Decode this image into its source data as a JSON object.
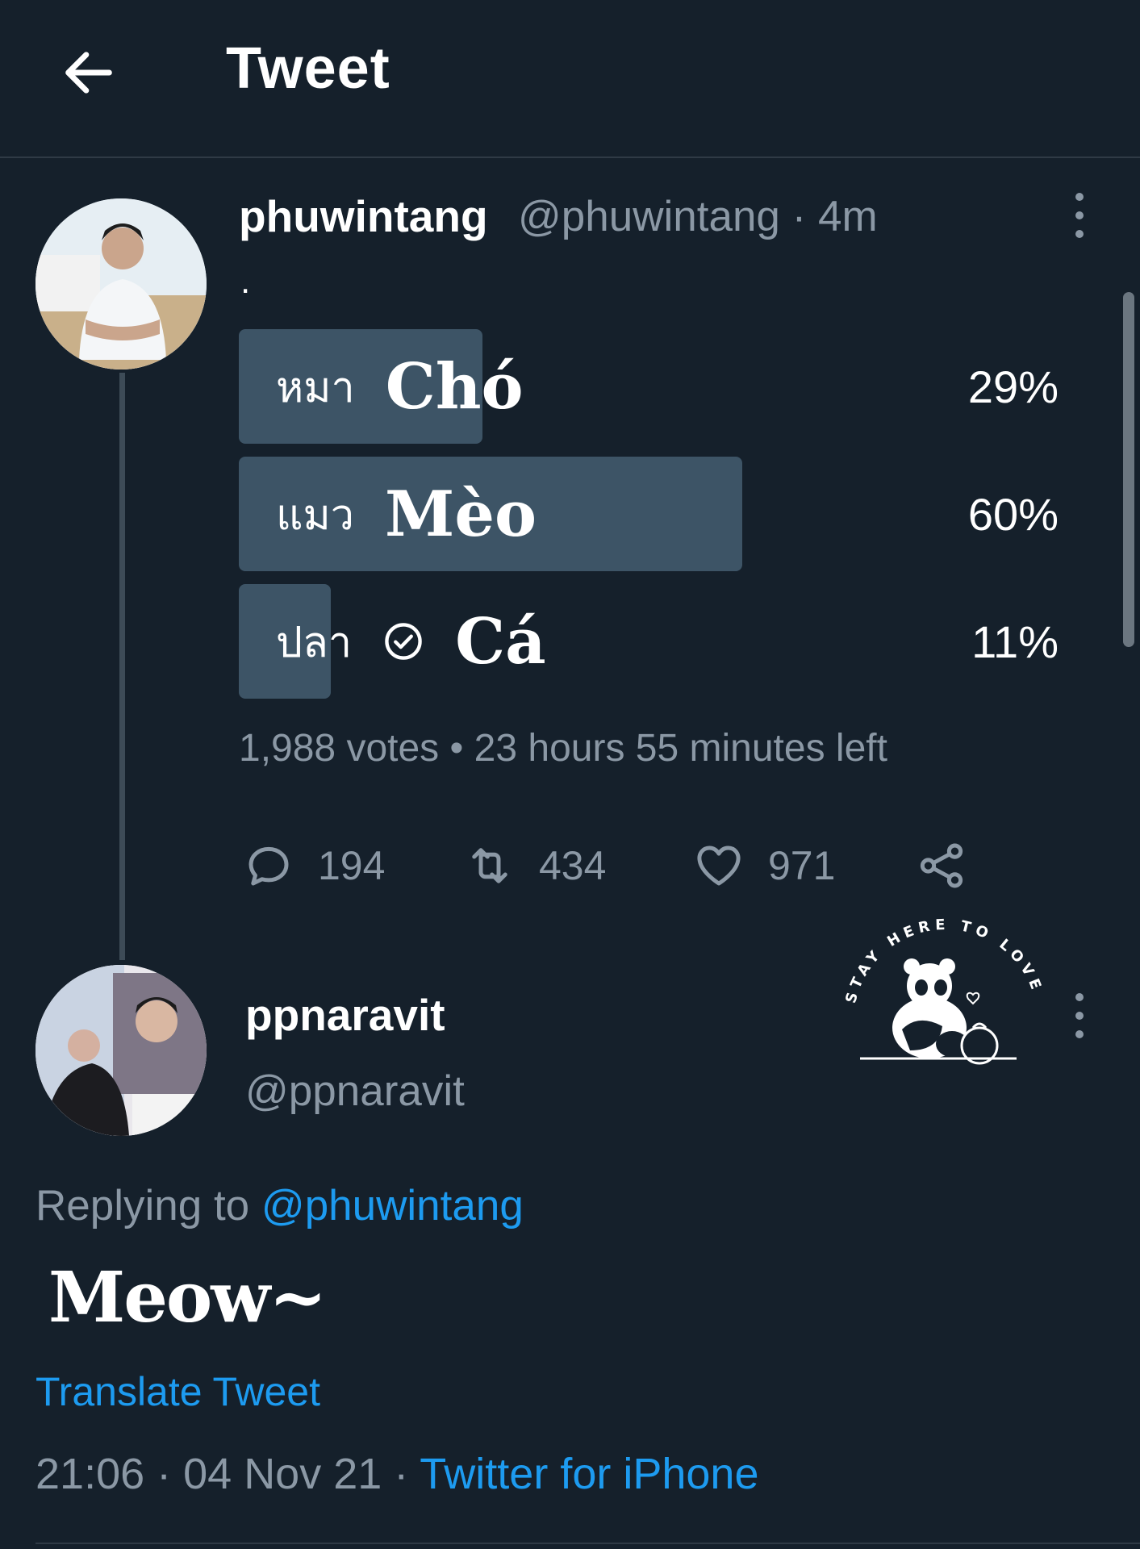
{
  "header": {
    "title": "Tweet",
    "back_icon": "arrow-left-icon"
  },
  "tweet": {
    "author_name": "phuwintang",
    "author_meta": "@phuwintang · 4m",
    "text": ".",
    "poll": {
      "options": [
        {
          "thai": "หมา",
          "viet": "Chó",
          "percent": 29,
          "percent_label": "29%",
          "selected": false
        },
        {
          "thai": "แมว",
          "viet": "Mèo",
          "percent": 60,
          "percent_label": "60%",
          "selected": false
        },
        {
          "thai": "ปลา",
          "viet": "Cá",
          "percent": 11,
          "percent_label": "11%",
          "selected": true
        }
      ],
      "meta": "1,988 votes • 23 hours 55 minutes left"
    },
    "actions": {
      "replies": "194",
      "retweets": "434",
      "likes": "971"
    }
  },
  "sticker": {
    "text": "STAY HERE TO LOVE"
  },
  "reply": {
    "author_name": "ppnaravit",
    "author_handle": "@ppnaravit",
    "replying_prefix": "Replying to",
    "replying_mention": "@phuwintang",
    "text": "Meow~",
    "translate_label": "Translate Tweet",
    "time_date": "21:06 · 04 Nov 21 · ",
    "source": "Twitter for iPhone"
  },
  "colors": {
    "background": "#15202b",
    "accent": "#1d9bf0",
    "muted": "#8b98a5",
    "poll_fill": "#3d5466"
  }
}
